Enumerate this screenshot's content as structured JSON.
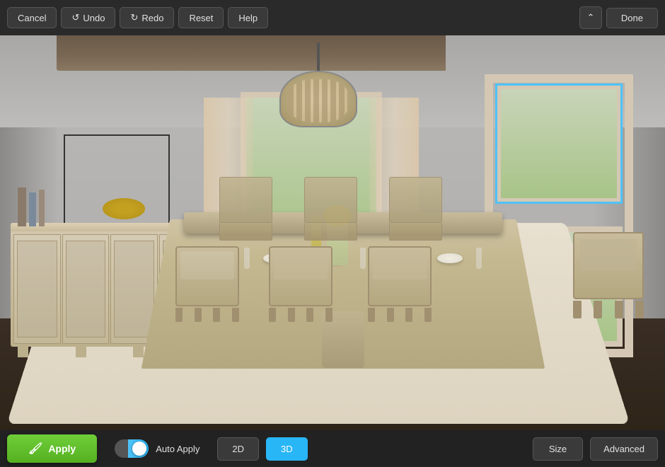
{
  "toolbar": {
    "cancel_label": "Cancel",
    "undo_label": "Undo",
    "redo_label": "Redo",
    "reset_label": "Reset",
    "help_label": "Help",
    "done_label": "Done"
  },
  "bottom_bar": {
    "apply_label": "Apply",
    "auto_apply_label": "Auto Apply",
    "view_2d_label": "2D",
    "view_3d_label": "3D",
    "size_label": "Size",
    "advanced_label": "Advanced",
    "toggle_state": "on"
  },
  "scene": {
    "description": "Dining room 3D render"
  }
}
